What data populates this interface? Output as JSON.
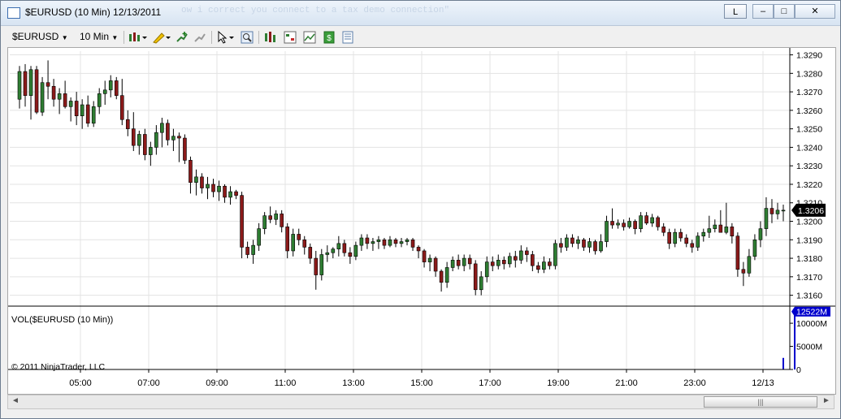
{
  "window": {
    "title": "$EURUSD (10 Min)  12/13/2011",
    "background_text": "ow i correct you connect to a tax demo connection\"",
    "layout_button": "L",
    "minimize_label": "–",
    "restore_label": "□",
    "close_label": "✕"
  },
  "toolbar": {
    "instrument": "$EURUSD",
    "interval": "10 Min",
    "icons": [
      "bar-style-icon",
      "draw-pencil-icon",
      "add-indicator-icon",
      "remove-indicator-icon",
      "cursor-icon",
      "zoom-icon",
      "strategy-icon",
      "chart-trader-icon",
      "performance-icon",
      "data-box-icon",
      "properties-icon"
    ]
  },
  "chart_data": {
    "type": "candlestick",
    "instrument_label": "$EURUSD",
    "price_axis": {
      "ticks": [
        "1.3290",
        "1.3280",
        "1.3270",
        "1.3260",
        "1.3250",
        "1.3240",
        "1.3230",
        "1.3220",
        "1.3210",
        "1.3200",
        "1.3190",
        "1.3180",
        "1.3170",
        "1.3160"
      ],
      "ylim": [
        1.3155,
        1.3292
      ],
      "last_price": "1.3206",
      "last_color": "#000000"
    },
    "time_axis": {
      "ticks": [
        "05:00",
        "07:00",
        "09:00",
        "11:00",
        "13:00",
        "15:00",
        "17:00",
        "19:00",
        "21:00",
        "23:00",
        "12/13"
      ]
    },
    "up_color": "#2e7d32",
    "down_color": "#8b1a1a",
    "candles": [
      {
        "o": 1.3266,
        "h": 1.3284,
        "l": 1.3261,
        "c": 1.3281
      },
      {
        "o": 1.3281,
        "h": 1.3285,
        "l": 1.3262,
        "c": 1.3268
      },
      {
        "o": 1.3268,
        "h": 1.3284,
        "l": 1.3255,
        "c": 1.3282
      },
      {
        "o": 1.3282,
        "h": 1.3284,
        "l": 1.3258,
        "c": 1.3259
      },
      {
        "o": 1.3259,
        "h": 1.3278,
        "l": 1.3257,
        "c": 1.3275
      },
      {
        "o": 1.3275,
        "h": 1.3287,
        "l": 1.3266,
        "c": 1.3273
      },
      {
        "o": 1.3273,
        "h": 1.3277,
        "l": 1.3262,
        "c": 1.3266
      },
      {
        "o": 1.3266,
        "h": 1.3272,
        "l": 1.3258,
        "c": 1.3269
      },
      {
        "o": 1.3269,
        "h": 1.3276,
        "l": 1.3261,
        "c": 1.3262
      },
      {
        "o": 1.3262,
        "h": 1.3267,
        "l": 1.3254,
        "c": 1.3265
      },
      {
        "o": 1.3265,
        "h": 1.327,
        "l": 1.3252,
        "c": 1.3257
      },
      {
        "o": 1.3257,
        "h": 1.3266,
        "l": 1.325,
        "c": 1.3263
      },
      {
        "o": 1.3263,
        "h": 1.3268,
        "l": 1.3251,
        "c": 1.3253
      },
      {
        "o": 1.3253,
        "h": 1.3265,
        "l": 1.3251,
        "c": 1.3262
      },
      {
        "o": 1.3262,
        "h": 1.3272,
        "l": 1.3258,
        "c": 1.3269
      },
      {
        "o": 1.3269,
        "h": 1.3276,
        "l": 1.3263,
        "c": 1.3271
      },
      {
        "o": 1.3271,
        "h": 1.3279,
        "l": 1.3267,
        "c": 1.3276
      },
      {
        "o": 1.3276,
        "h": 1.3278,
        "l": 1.3266,
        "c": 1.3268
      },
      {
        "o": 1.3268,
        "h": 1.3277,
        "l": 1.3252,
        "c": 1.3255
      },
      {
        "o": 1.3255,
        "h": 1.326,
        "l": 1.3246,
        "c": 1.325
      },
      {
        "o": 1.325,
        "h": 1.3259,
        "l": 1.3238,
        "c": 1.3241
      },
      {
        "o": 1.3241,
        "h": 1.3249,
        "l": 1.3236,
        "c": 1.3247
      },
      {
        "o": 1.3247,
        "h": 1.325,
        "l": 1.3233,
        "c": 1.3236
      },
      {
        "o": 1.3236,
        "h": 1.3243,
        "l": 1.323,
        "c": 1.324
      },
      {
        "o": 1.324,
        "h": 1.3252,
        "l": 1.3236,
        "c": 1.3248
      },
      {
        "o": 1.3248,
        "h": 1.3256,
        "l": 1.324,
        "c": 1.3253
      },
      {
        "o": 1.3253,
        "h": 1.3255,
        "l": 1.3241,
        "c": 1.3244
      },
      {
        "o": 1.3244,
        "h": 1.325,
        "l": 1.3238,
        "c": 1.3246
      },
      {
        "o": 1.3246,
        "h": 1.3248,
        "l": 1.3232,
        "c": 1.3245
      },
      {
        "o": 1.3245,
        "h": 1.3247,
        "l": 1.3231,
        "c": 1.3233
      },
      {
        "o": 1.3233,
        "h": 1.3235,
        "l": 1.3215,
        "c": 1.3221
      },
      {
        "o": 1.3221,
        "h": 1.3228,
        "l": 1.3214,
        "c": 1.3224
      },
      {
        "o": 1.3224,
        "h": 1.3226,
        "l": 1.3215,
        "c": 1.3218
      },
      {
        "o": 1.3218,
        "h": 1.3224,
        "l": 1.3212,
        "c": 1.322
      },
      {
        "o": 1.322,
        "h": 1.3223,
        "l": 1.3213,
        "c": 1.3216
      },
      {
        "o": 1.3216,
        "h": 1.3222,
        "l": 1.3211,
        "c": 1.3219
      },
      {
        "o": 1.3219,
        "h": 1.322,
        "l": 1.321,
        "c": 1.3213
      },
      {
        "o": 1.3213,
        "h": 1.3219,
        "l": 1.3209,
        "c": 1.3216
      },
      {
        "o": 1.3216,
        "h": 1.3217,
        "l": 1.3212,
        "c": 1.3214
      },
      {
        "o": 1.3214,
        "h": 1.3216,
        "l": 1.318,
        "c": 1.3186
      },
      {
        "o": 1.3186,
        "h": 1.3189,
        "l": 1.318,
        "c": 1.3182
      },
      {
        "o": 1.3182,
        "h": 1.319,
        "l": 1.3177,
        "c": 1.3187
      },
      {
        "o": 1.3187,
        "h": 1.3199,
        "l": 1.3184,
        "c": 1.3196
      },
      {
        "o": 1.3196,
        "h": 1.3205,
        "l": 1.3193,
        "c": 1.3203
      },
      {
        "o": 1.3203,
        "h": 1.3208,
        "l": 1.3199,
        "c": 1.3201
      },
      {
        "o": 1.3201,
        "h": 1.3206,
        "l": 1.3198,
        "c": 1.3204
      },
      {
        "o": 1.3204,
        "h": 1.3206,
        "l": 1.3194,
        "c": 1.3197
      },
      {
        "o": 1.3197,
        "h": 1.3199,
        "l": 1.318,
        "c": 1.3184
      },
      {
        "o": 1.3184,
        "h": 1.3196,
        "l": 1.3181,
        "c": 1.3193
      },
      {
        "o": 1.3193,
        "h": 1.3196,
        "l": 1.3187,
        "c": 1.319
      },
      {
        "o": 1.319,
        "h": 1.3192,
        "l": 1.3182,
        "c": 1.3186
      },
      {
        "o": 1.3186,
        "h": 1.3188,
        "l": 1.3177,
        "c": 1.318
      },
      {
        "o": 1.318,
        "h": 1.3184,
        "l": 1.3163,
        "c": 1.3171
      },
      {
        "o": 1.3171,
        "h": 1.3185,
        "l": 1.3168,
        "c": 1.3182
      },
      {
        "o": 1.3182,
        "h": 1.3187,
        "l": 1.3178,
        "c": 1.3183
      },
      {
        "o": 1.3183,
        "h": 1.3186,
        "l": 1.318,
        "c": 1.3185
      },
      {
        "o": 1.3185,
        "h": 1.3192,
        "l": 1.3181,
        "c": 1.3188
      },
      {
        "o": 1.3188,
        "h": 1.319,
        "l": 1.3181,
        "c": 1.3183
      },
      {
        "o": 1.3183,
        "h": 1.3186,
        "l": 1.3177,
        "c": 1.3181
      },
      {
        "o": 1.3181,
        "h": 1.3189,
        "l": 1.3179,
        "c": 1.3187
      },
      {
        "o": 1.3187,
        "h": 1.3193,
        "l": 1.3184,
        "c": 1.3191
      },
      {
        "o": 1.3191,
        "h": 1.3193,
        "l": 1.3185,
        "c": 1.3188
      },
      {
        "o": 1.3188,
        "h": 1.3191,
        "l": 1.3184,
        "c": 1.3189
      },
      {
        "o": 1.3189,
        "h": 1.3192,
        "l": 1.3185,
        "c": 1.319
      },
      {
        "o": 1.319,
        "h": 1.3191,
        "l": 1.3185,
        "c": 1.3187
      },
      {
        "o": 1.3187,
        "h": 1.3192,
        "l": 1.3186,
        "c": 1.319
      },
      {
        "o": 1.319,
        "h": 1.3191,
        "l": 1.3186,
        "c": 1.3188
      },
      {
        "o": 1.3188,
        "h": 1.3191,
        "l": 1.3186,
        "c": 1.3189
      },
      {
        "o": 1.3189,
        "h": 1.3191,
        "l": 1.3187,
        "c": 1.319
      },
      {
        "o": 1.319,
        "h": 1.3191,
        "l": 1.3184,
        "c": 1.3186
      },
      {
        "o": 1.3186,
        "h": 1.3187,
        "l": 1.318,
        "c": 1.3184
      },
      {
        "o": 1.3184,
        "h": 1.3185,
        "l": 1.3175,
        "c": 1.3178
      },
      {
        "o": 1.3178,
        "h": 1.3182,
        "l": 1.3173,
        "c": 1.318
      },
      {
        "o": 1.318,
        "h": 1.3181,
        "l": 1.317,
        "c": 1.3173
      },
      {
        "o": 1.3173,
        "h": 1.3174,
        "l": 1.3162,
        "c": 1.3167
      },
      {
        "o": 1.3167,
        "h": 1.3178,
        "l": 1.3164,
        "c": 1.3175
      },
      {
        "o": 1.3175,
        "h": 1.3181,
        "l": 1.3173,
        "c": 1.3179
      },
      {
        "o": 1.3179,
        "h": 1.3182,
        "l": 1.3174,
        "c": 1.3176
      },
      {
        "o": 1.3176,
        "h": 1.3182,
        "l": 1.3173,
        "c": 1.318
      },
      {
        "o": 1.318,
        "h": 1.3182,
        "l": 1.3174,
        "c": 1.3177
      },
      {
        "o": 1.3177,
        "h": 1.3179,
        "l": 1.316,
        "c": 1.3163
      },
      {
        "o": 1.3163,
        "h": 1.3173,
        "l": 1.316,
        "c": 1.317
      },
      {
        "o": 1.317,
        "h": 1.3181,
        "l": 1.3167,
        "c": 1.3178
      },
      {
        "o": 1.3178,
        "h": 1.3181,
        "l": 1.3173,
        "c": 1.3176
      },
      {
        "o": 1.3176,
        "h": 1.3182,
        "l": 1.3174,
        "c": 1.3179
      },
      {
        "o": 1.3179,
        "h": 1.3181,
        "l": 1.3174,
        "c": 1.3177
      },
      {
        "o": 1.3177,
        "h": 1.3183,
        "l": 1.3175,
        "c": 1.3181
      },
      {
        "o": 1.3181,
        "h": 1.3184,
        "l": 1.3175,
        "c": 1.3179
      },
      {
        "o": 1.3179,
        "h": 1.3187,
        "l": 1.3177,
        "c": 1.3184
      },
      {
        "o": 1.3184,
        "h": 1.3186,
        "l": 1.3178,
        "c": 1.3182
      },
      {
        "o": 1.3182,
        "h": 1.3184,
        "l": 1.3173,
        "c": 1.3176
      },
      {
        "o": 1.3176,
        "h": 1.3178,
        "l": 1.3172,
        "c": 1.3174
      },
      {
        "o": 1.3174,
        "h": 1.3181,
        "l": 1.3172,
        "c": 1.3178
      },
      {
        "o": 1.3178,
        "h": 1.318,
        "l": 1.3174,
        "c": 1.3176
      },
      {
        "o": 1.3176,
        "h": 1.319,
        "l": 1.3174,
        "c": 1.3188
      },
      {
        "o": 1.3188,
        "h": 1.3191,
        "l": 1.3183,
        "c": 1.3186
      },
      {
        "o": 1.3186,
        "h": 1.3193,
        "l": 1.3184,
        "c": 1.3191
      },
      {
        "o": 1.3191,
        "h": 1.3193,
        "l": 1.3186,
        "c": 1.3188
      },
      {
        "o": 1.3188,
        "h": 1.3192,
        "l": 1.3185,
        "c": 1.319
      },
      {
        "o": 1.319,
        "h": 1.3191,
        "l": 1.3184,
        "c": 1.3186
      },
      {
        "o": 1.3186,
        "h": 1.3191,
        "l": 1.3183,
        "c": 1.3189
      },
      {
        "o": 1.3189,
        "h": 1.319,
        "l": 1.3182,
        "c": 1.3184
      },
      {
        "o": 1.3184,
        "h": 1.3193,
        "l": 1.3183,
        "c": 1.3189
      },
      {
        "o": 1.3189,
        "h": 1.3203,
        "l": 1.3186,
        "c": 1.32
      },
      {
        "o": 1.32,
        "h": 1.3207,
        "l": 1.3196,
        "c": 1.3198
      },
      {
        "o": 1.3198,
        "h": 1.3201,
        "l": 1.3196,
        "c": 1.3199
      },
      {
        "o": 1.3199,
        "h": 1.3201,
        "l": 1.3195,
        "c": 1.3197
      },
      {
        "o": 1.3197,
        "h": 1.3202,
        "l": 1.3196,
        "c": 1.32
      },
      {
        "o": 1.32,
        "h": 1.3201,
        "l": 1.3193,
        "c": 1.3196
      },
      {
        "o": 1.3196,
        "h": 1.3205,
        "l": 1.3194,
        "c": 1.3203
      },
      {
        "o": 1.3203,
        "h": 1.3205,
        "l": 1.3198,
        "c": 1.3199
      },
      {
        "o": 1.3199,
        "h": 1.3204,
        "l": 1.3197,
        "c": 1.3202
      },
      {
        "o": 1.3202,
        "h": 1.3203,
        "l": 1.3195,
        "c": 1.3197
      },
      {
        "o": 1.3197,
        "h": 1.3199,
        "l": 1.3192,
        "c": 1.3194
      },
      {
        "o": 1.3194,
        "h": 1.3196,
        "l": 1.3185,
        "c": 1.3188
      },
      {
        "o": 1.3188,
        "h": 1.3196,
        "l": 1.3186,
        "c": 1.3194
      },
      {
        "o": 1.3194,
        "h": 1.3196,
        "l": 1.3189,
        "c": 1.3191
      },
      {
        "o": 1.3191,
        "h": 1.3193,
        "l": 1.3186,
        "c": 1.3188
      },
      {
        "o": 1.3188,
        "h": 1.319,
        "l": 1.3183,
        "c": 1.3186
      },
      {
        "o": 1.3186,
        "h": 1.3194,
        "l": 1.3184,
        "c": 1.3192
      },
      {
        "o": 1.3192,
        "h": 1.3196,
        "l": 1.3189,
        "c": 1.3194
      },
      {
        "o": 1.3194,
        "h": 1.3203,
        "l": 1.3191,
        "c": 1.3196
      },
      {
        "o": 1.3196,
        "h": 1.3201,
        "l": 1.3194,
        "c": 1.3198
      },
      {
        "o": 1.3198,
        "h": 1.3206,
        "l": 1.3195,
        "c": 1.3194
      },
      {
        "o": 1.3194,
        "h": 1.321,
        "l": 1.3193,
        "c": 1.3197
      },
      {
        "o": 1.3197,
        "h": 1.3199,
        "l": 1.3188,
        "c": 1.3192
      },
      {
        "o": 1.3192,
        "h": 1.3194,
        "l": 1.317,
        "c": 1.3174
      },
      {
        "o": 1.3174,
        "h": 1.3178,
        "l": 1.3165,
        "c": 1.3172
      },
      {
        "o": 1.3172,
        "h": 1.3185,
        "l": 1.317,
        "c": 1.3181
      },
      {
        "o": 1.3181,
        "h": 1.3193,
        "l": 1.3179,
        "c": 1.319
      },
      {
        "o": 1.319,
        "h": 1.32,
        "l": 1.3186,
        "c": 1.3196
      },
      {
        "o": 1.3196,
        "h": 1.3213,
        "l": 1.3192,
        "c": 1.3207
      },
      {
        "o": 1.3207,
        "h": 1.3212,
        "l": 1.3199,
        "c": 1.3204
      },
      {
        "o": 1.3204,
        "h": 1.321,
        "l": 1.3201,
        "c": 1.3206
      },
      {
        "o": 1.3206,
        "h": 1.3209,
        "l": 1.32,
        "c": 1.3206
      }
    ],
    "volume_panel": {
      "label": "VOL($EURUSD (10 Min))",
      "ticks": [
        "10000M",
        "5000M",
        "0"
      ],
      "last_volume": "12522M",
      "bar_color": "#0000cc",
      "ylim": [
        0,
        13000
      ],
      "bars_in_millions": [
        {
          "index": 134,
          "value": 2500
        },
        {
          "index": 136,
          "value": 12522
        }
      ]
    },
    "copyright": "© 2011 NinjaTrader, LLC"
  },
  "scrollbar": {
    "left_arrow": "◄",
    "right_arrow": "►",
    "thumb_grip": "|||"
  }
}
